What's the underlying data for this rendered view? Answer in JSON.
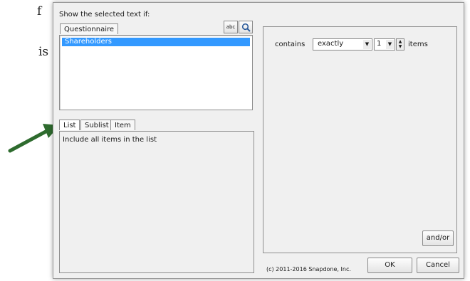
{
  "background": {
    "frag1": "f",
    "frag2": "is"
  },
  "dialog": {
    "prompt": "Show the selected text if:",
    "top_tab": "Questionnaire",
    "abc_label": "abc",
    "search_icon": "magnifier-icon",
    "list_items": [
      "Shareholders"
    ],
    "bottom_tabs": [
      "List",
      "Sublist",
      "Item"
    ],
    "bottom_text": "Include all items in the list",
    "condition": {
      "contains_label": "contains",
      "mode_value": "exactly",
      "count_value": "1",
      "items_label": "items"
    },
    "andor_label": "and/or",
    "copyright": "(c) 2011-2016 Snapdone, Inc.",
    "ok_label": "OK",
    "cancel_label": "Cancel"
  },
  "arrow": {
    "color": "#2e6b2e"
  }
}
